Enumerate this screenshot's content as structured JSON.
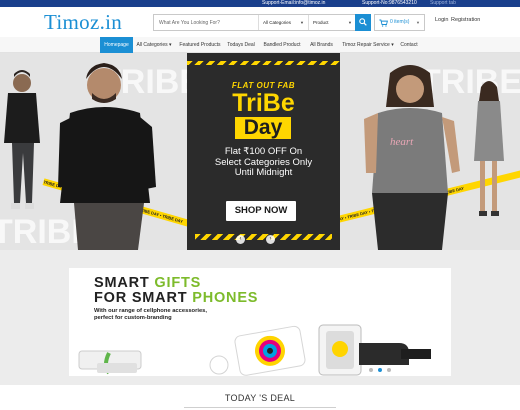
{
  "topbar": {
    "support_email": "Support-Email:info@timoz.in",
    "support_phone": "Support-No:9876543210",
    "right_text": "Support tab"
  },
  "header": {
    "logo": "Timoz.in",
    "search_placeholder": "What Are You Looking For?",
    "category_select": "All Categories",
    "product_select": "Product",
    "cart_label": "0 item(s)",
    "login": "Login",
    "register": "Registration"
  },
  "nav": {
    "items": [
      {
        "label": "Homepage",
        "active": true
      },
      {
        "label": "All Categories ▾"
      },
      {
        "label": "Featured Products"
      },
      {
        "label": "Todays Deal"
      },
      {
        "label": "Bandled Product"
      },
      {
        "label": "All Brands"
      },
      {
        "label": "Timoz Repair Service ▾"
      },
      {
        "label": "Contact"
      }
    ]
  },
  "hero": {
    "flat_out": "FLAT OUT FAB",
    "tribe": "TriBe",
    "day": "Day",
    "offer_line1": "Flat ₹100 OFF On",
    "offer_line2": "Select Categories Only",
    "offer_line3": "Until Midnight",
    "cta": "SHOP NOW",
    "ghost_left": "TRIBE",
    "ghost_right": "TRIBE",
    "tape_text": "TRIBE DAY • TRIBE DAY • TRIBE DAY • TRIBE DAY • TRIBE DAY • TRIBE DAY",
    "prev": "‹",
    "next": "›",
    "tshirt_print": "heart",
    "accent": "#ffd600"
  },
  "banner": {
    "smart": "SMART",
    "gifts": "GIFTS",
    "for_smart": "FOR SMART",
    "phones": "PHONES",
    "sub_line1": "With our range of cellphone accessories,",
    "sub_line2": "perfect for custom-branding"
  },
  "deal": {
    "title": "TODAY 'S DEAL"
  },
  "colors": {
    "brand_blue": "#1b8fd4",
    "topbar": "#1a3f8c",
    "green": "#7dbb2b"
  }
}
